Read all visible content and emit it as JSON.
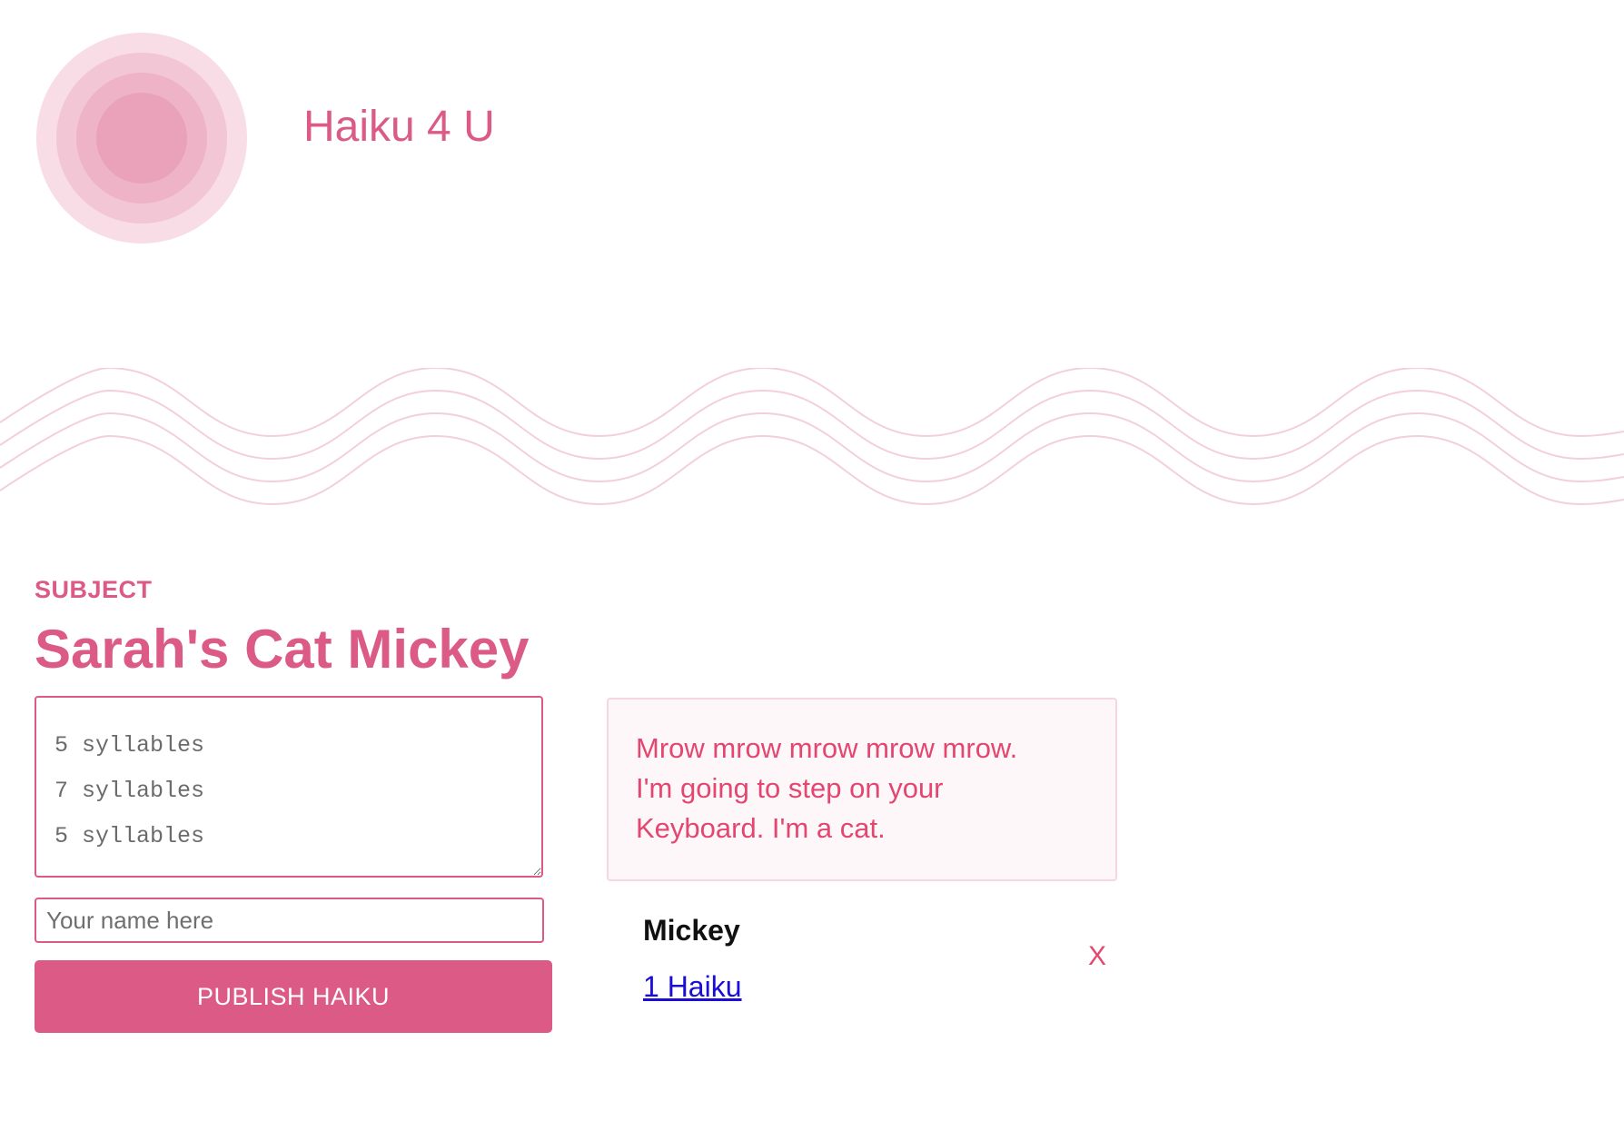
{
  "header": {
    "logo_icon": "concentric-circles-logo",
    "title": "Haiku 4 U"
  },
  "subject": {
    "label": "SUBJECT",
    "title": "Sarah's Cat Mickey"
  },
  "form": {
    "haiku_placeholder": "5 syllables\n7 syllables\n5 syllables",
    "name_placeholder": "Your name here",
    "publish_label": "PUBLISH HAIKU"
  },
  "haiku": {
    "lines": [
      "Mrow mrow mrow mrow mrow.",
      "I'm going to step on your",
      "Keyboard. I'm a cat."
    ],
    "author": "Mickey",
    "count_link": "1 Haiku",
    "delete_label": "X"
  },
  "colors": {
    "accent": "#db5a86",
    "haiku_text": "#e3466f",
    "card_background": "#fdf7fa",
    "card_border": "#f6d6e1",
    "wave_stroke": "#f3cfdc",
    "link": "#1a0dd6"
  }
}
